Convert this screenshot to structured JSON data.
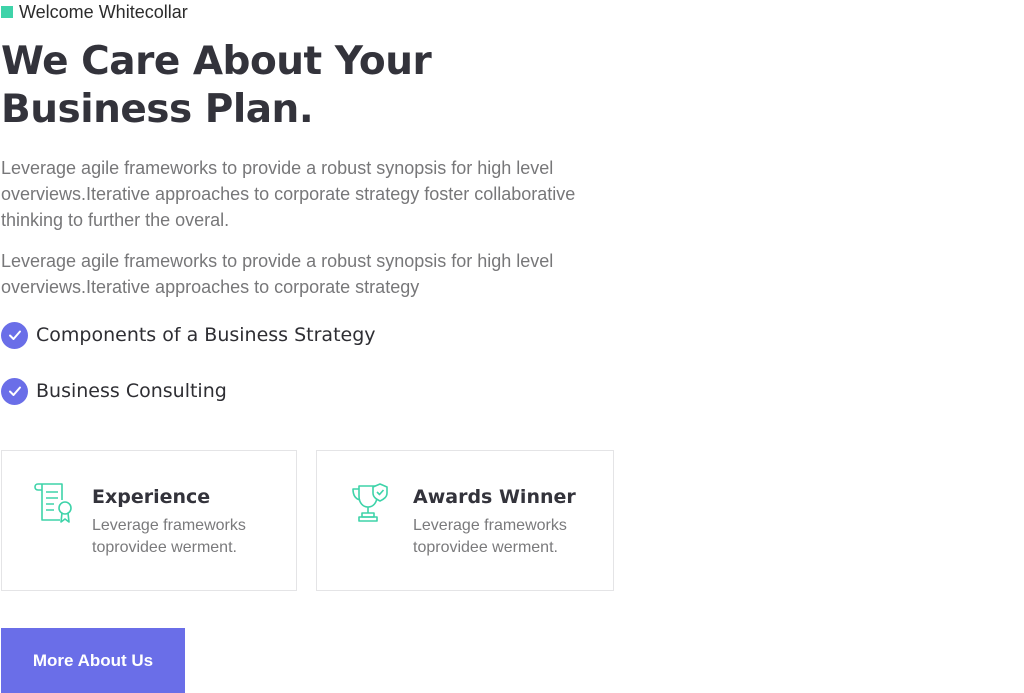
{
  "eyebrow": {
    "label": "Welcome Whitecollar"
  },
  "title": {
    "line1": "We Care About Your",
    "line2": "Business Plan."
  },
  "paragraphs": [
    "Leverage agile frameworks to provide a robust synopsis for high level overviews.Iterative approaches to corporate strategy foster collaborative thinking to further the overal.",
    "Leverage agile frameworks to provide a robust synopsis for high level overviews.Iterative approaches to corporate strategy"
  ],
  "checklist": [
    {
      "label": "Components of a Business Strategy",
      "icon": "check-circle-icon"
    },
    {
      "label": "Business Consulting",
      "icon": "check-circle-icon"
    }
  ],
  "cards": [
    {
      "title": "Experience",
      "text": "Leverage frameworks toprovidee werment.",
      "icon": "certificate-icon"
    },
    {
      "title": "Awards Winner",
      "text": "Leverage frameworks toprovidee werment.",
      "icon": "trophy-icon"
    }
  ],
  "button": {
    "label": "More About Us"
  },
  "colors": {
    "accent": "#6a6ee8",
    "green": "#3ed3a9",
    "heading": "#33333b",
    "body": "#777779"
  }
}
